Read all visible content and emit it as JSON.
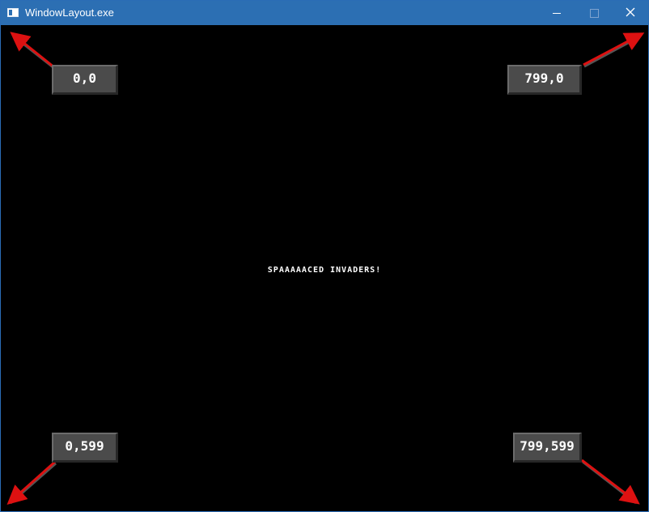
{
  "window": {
    "title": "WindowLayout.exe",
    "titlebar_color": "#2c6fb3",
    "buttons": {
      "minimize_icon": "minimize-icon",
      "maximize_icon": "maximize-icon",
      "close_icon": "close-icon"
    }
  },
  "client": {
    "background": "#000000",
    "center_text": "SPAAAAACED INVADERS!",
    "arrow_color": "#dd1111",
    "corners": {
      "top_left": "0,0",
      "top_right": "799,0",
      "bottom_left": "0,599",
      "bottom_right": "799,599"
    }
  }
}
